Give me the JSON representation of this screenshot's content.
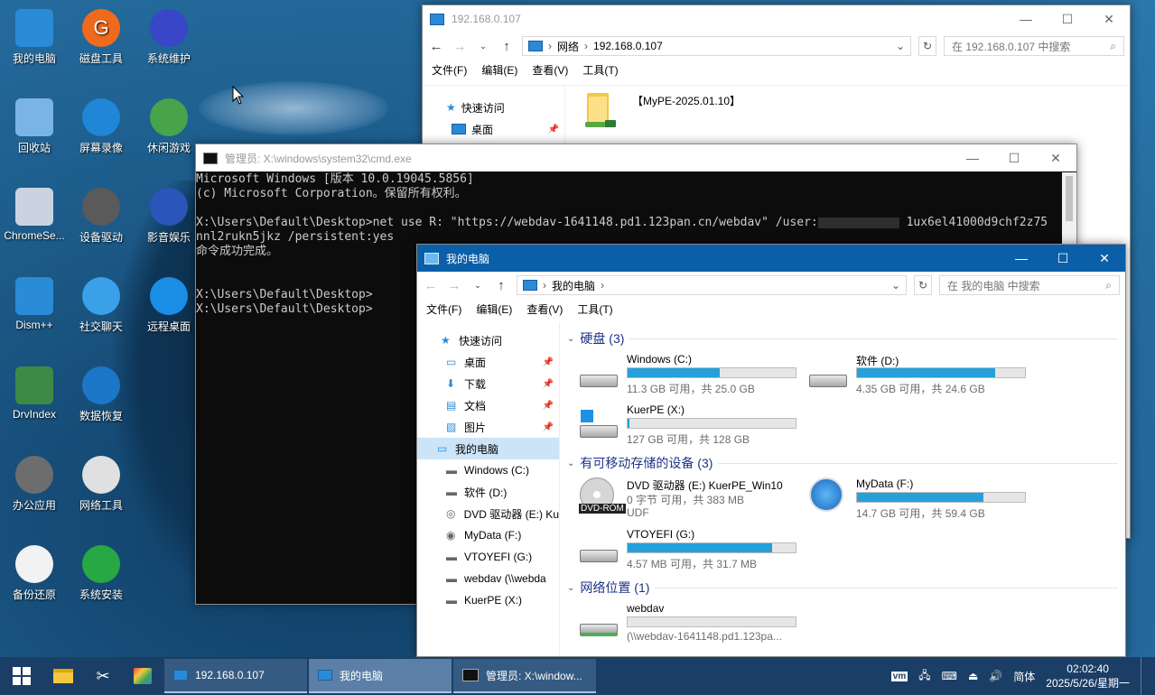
{
  "desktop": {
    "icons": [
      {
        "label": "我的电脑",
        "icon": "computer-icon",
        "color": "#2a8bd6"
      },
      {
        "label": "磁盘工具",
        "icon": "disk-tool-icon",
        "color": "#f06a1e",
        "glyph": "G"
      },
      {
        "label": "系统维护",
        "icon": "system-maintenance-icon",
        "color": "#3a46c8"
      },
      {
        "label": "回收站",
        "icon": "recycle-bin-icon",
        "color": "#7ab4e6"
      },
      {
        "label": "屏幕录像",
        "icon": "screen-record-icon",
        "color": "#1f86d8"
      },
      {
        "label": "休闲游戏",
        "icon": "game-icon",
        "color": "#47a44a"
      },
      {
        "label": "ChromeSe...",
        "icon": "chrome-setup-icon",
        "color": "#c9d4e0"
      },
      {
        "label": "设备驱动",
        "icon": "device-driver-icon",
        "color": "#5a5a5a"
      },
      {
        "label": "影音娱乐",
        "icon": "media-icon",
        "color": "#2b55b8"
      },
      {
        "label": "Dism++",
        "icon": "dism-icon",
        "color": "#2a8bd6"
      },
      {
        "label": "社交聊天",
        "icon": "chat-icon",
        "color": "#3aa0e8"
      },
      {
        "label": "远程桌面",
        "icon": "remote-desktop-icon",
        "color": "#1b8ee6"
      },
      {
        "label": "DrvIndex",
        "icon": "drvindex-icon",
        "color": "#3c8a46"
      },
      {
        "label": "数据恢复",
        "icon": "data-recovery-icon",
        "color": "#1c77c8"
      },
      {
        "label": "办公应用",
        "icon": "office-icon",
        "color": "#6d6d6d"
      },
      {
        "label": "网络工具",
        "icon": "network-tool-icon",
        "color": "#e0e0e0"
      },
      {
        "label": "备份还原",
        "icon": "backup-icon",
        "color": "#f2f2f2"
      },
      {
        "label": "系统安装",
        "icon": "system-install-icon",
        "color": "#28a745"
      }
    ]
  },
  "network_window": {
    "title": "192.168.0.107",
    "path": [
      "网络",
      "192.168.0.107"
    ],
    "search_placeholder": "在 192.168.0.107 中搜索",
    "menu": [
      "文件(F)",
      "编辑(E)",
      "查看(V)",
      "工具(T)"
    ],
    "nav": [
      {
        "label": "快速访问"
      },
      {
        "label": "桌面"
      }
    ],
    "share": "【MyPE-2025.01.10】"
  },
  "cmd_window": {
    "title": "管理员: X:\\windows\\system32\\cmd.exe",
    "lines": [
      "Microsoft Windows [版本 10.0.19045.5856]",
      "(c) Microsoft Corporation。保留所有权利。",
      "",
      "X:\\Users\\Default\\Desktop>net use R: \"https://webdav-1641148.pd1.123pan.cn/webdav\" /user:",
      "nnl2rukn5jkz /persistent:yes",
      "命令成功完成。",
      "",
      "",
      "X:\\Users\\Default\\Desktop>",
      "X:\\Users\\Default\\Desktop>"
    ],
    "line3_tail": " 1ux6el41000d9chf2z75"
  },
  "pc_window": {
    "title": "我的电脑",
    "path": [
      "我的电脑"
    ],
    "search_placeholder": "在 我的电脑 中搜索",
    "menu": [
      "文件(F)",
      "编辑(E)",
      "查看(V)",
      "工具(T)"
    ],
    "nav": [
      {
        "label": "快速访问",
        "pinned": false
      },
      {
        "label": "桌面",
        "pinned": true
      },
      {
        "label": "下载",
        "pinned": true
      },
      {
        "label": "文档",
        "pinned": true
      },
      {
        "label": "图片",
        "pinned": true
      },
      {
        "label": "我的电脑",
        "pinned": false
      },
      {
        "label": "Windows (C:)",
        "pinned": false
      },
      {
        "label": "软件 (D:)",
        "pinned": false
      },
      {
        "label": "DVD 驱动器 (E:) Ku",
        "pinned": false
      },
      {
        "label": "MyData (F:)",
        "pinned": false
      },
      {
        "label": "VTOYEFI (G:)",
        "pinned": false
      },
      {
        "label": "webdav (\\\\webda",
        "pinned": false
      },
      {
        "label": "KuerPE (X:)",
        "pinned": false
      }
    ],
    "groups": [
      {
        "title": "硬盘 (3)"
      },
      {
        "title": "有可移动存储的设备 (3)"
      },
      {
        "title": "网络位置 (1)"
      }
    ],
    "drives": [
      {
        "name": "Windows (C:)",
        "info": "11.3 GB 可用，共 25.0 GB",
        "used": 0.55
      },
      {
        "name": "软件 (D:)",
        "info": "4.35 GB 可用，共 24.6 GB",
        "used": 0.82
      },
      {
        "name": "KuerPE (X:)",
        "info": "127 GB 可用，共 128 GB",
        "used": 0.01
      },
      {
        "name": "DVD 驱动器 (E:) KuerPE_Win10",
        "info": "0 字节 可用，共 383 MB",
        "info2": "UDF",
        "dvd_label": "DVD-ROM"
      },
      {
        "name": "MyData (F:)",
        "info": "14.7 GB 可用，共 59.4 GB",
        "used": 0.75
      },
      {
        "name": "VTOYEFI (G:)",
        "info": "4.57 MB 可用，共 31.7 MB",
        "used": 0.86
      },
      {
        "name": "webdav",
        "info": "(\\\\webdav-1641148.pd1.123pa...",
        "used": 0.0
      }
    ]
  },
  "taskbar": {
    "apps": [
      {
        "label": "192.168.0.107",
        "icon": "network-folder-icon"
      },
      {
        "label": "我的电脑",
        "icon": "computer-icon"
      },
      {
        "label": "管理员: X:\\window...",
        "icon": "cmd-icon"
      }
    ],
    "ime": "简体",
    "time": "02:02:40",
    "date": "2025/5/26/星期一"
  }
}
